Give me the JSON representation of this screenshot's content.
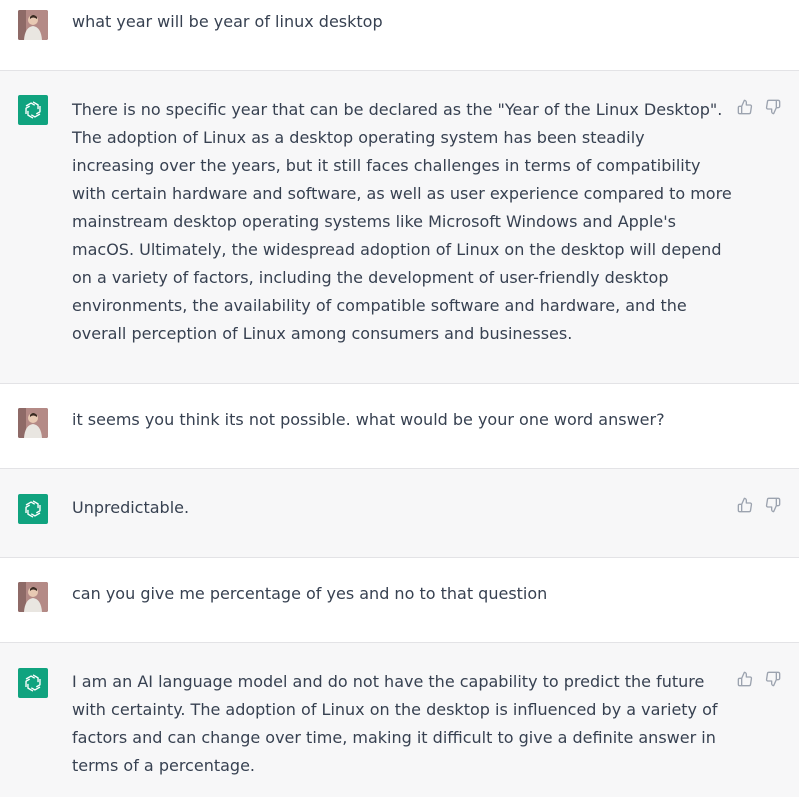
{
  "messages": [
    {
      "role": "user",
      "text": "what year will be year of linux desktop"
    },
    {
      "role": "assistant",
      "text": "There is no specific year that can be declared as the \"Year of the Linux Desktop\". The adoption of Linux as a desktop operating system has been steadily increasing over the years, but it still faces challenges in terms of compatibility with certain hardware and software, as well as user experience compared to more mainstream desktop operating systems like Microsoft Windows and Apple's macOS. Ultimately, the widespread adoption of Linux on the desktop will depend on a variety of factors, including the development of user-friendly desktop environments, the availability of compatible software and hardware, and the overall perception of Linux among consumers and businesses."
    },
    {
      "role": "user",
      "text": "it seems you think its not possible. what would be your one word answer?"
    },
    {
      "role": "assistant",
      "text": "Unpredictable."
    },
    {
      "role": "user",
      "text": "can you give me percentage of yes and no to that question"
    },
    {
      "role": "assistant",
      "text": "I am an AI language model and do not have the capability to predict the future with certainty. The adoption of Linux on the desktop is influenced by a variety of factors and can change over time, making it difficult to give a definite answer in terms of a percentage."
    }
  ],
  "icons": {
    "user_avatar": "user-avatar-icon",
    "assistant_avatar": "openai-logo-icon",
    "thumbs_up": "thumbs-up-icon",
    "thumbs_down": "thumbs-down-icon"
  },
  "colors": {
    "assistant_bg": "#f7f7f8",
    "user_bg": "#ffffff",
    "brand": "#10a37f",
    "text": "#374151",
    "icon": "#9ca3af"
  }
}
